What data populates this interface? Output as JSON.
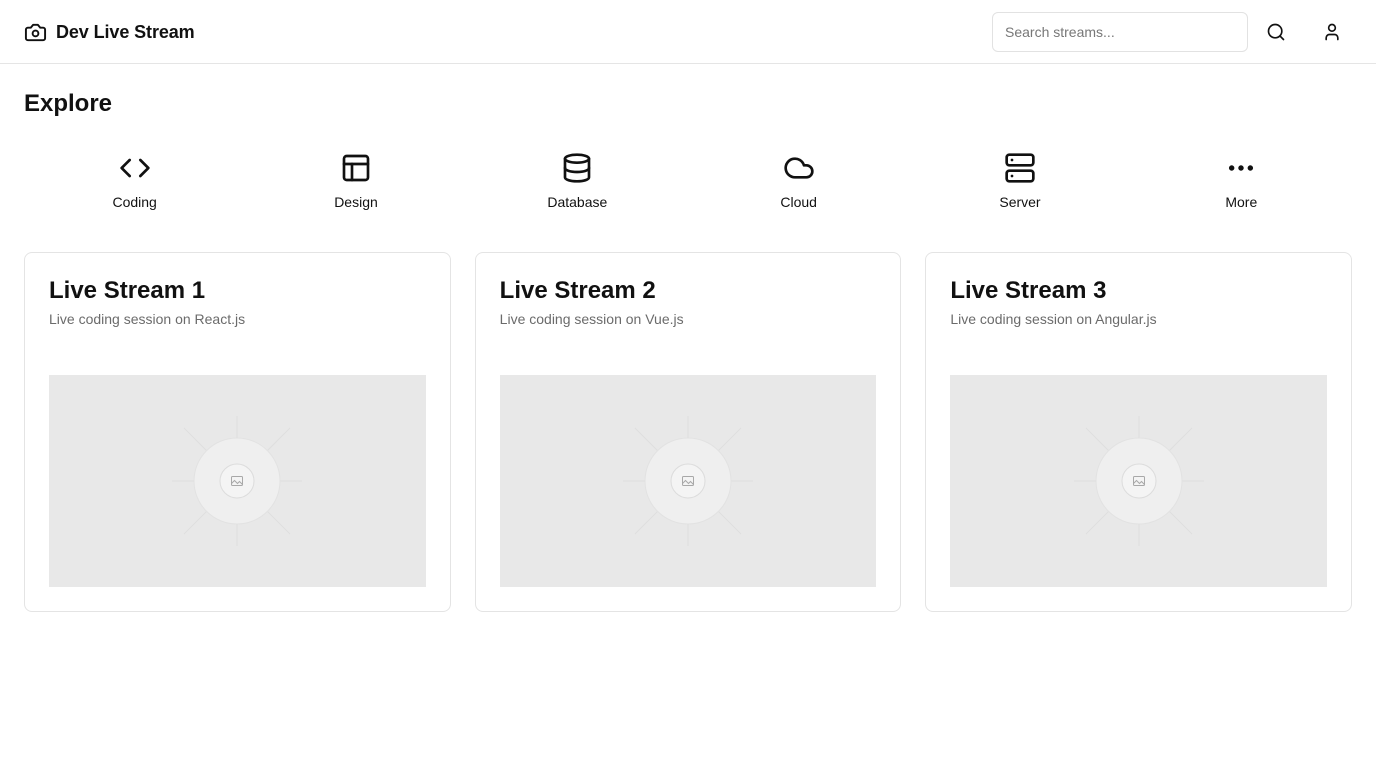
{
  "header": {
    "brand_icon": "camera-icon",
    "title": "Dev Live Stream",
    "search_placeholder": "Search streams...",
    "search_value": "",
    "search_icon": "search-icon",
    "profile_icon": "user-icon"
  },
  "main": {
    "title": "Explore",
    "categories": [
      {
        "label": "Coding",
        "icon": "code-icon"
      },
      {
        "label": "Design",
        "icon": "layout-icon"
      },
      {
        "label": "Database",
        "icon": "database-icon"
      },
      {
        "label": "Cloud",
        "icon": "cloud-icon"
      },
      {
        "label": "Server",
        "icon": "server-icon"
      },
      {
        "label": "More",
        "icon": "more-horizontal-icon"
      }
    ],
    "streams": [
      {
        "title": "Live Stream 1",
        "description": "Live coding session on React.js",
        "thumbnail": "image-placeholder-icon"
      },
      {
        "title": "Live Stream 2",
        "description": "Live coding session on Vue.js",
        "thumbnail": "image-placeholder-icon"
      },
      {
        "title": "Live Stream 3",
        "description": "Live coding session on Angular.js",
        "thumbnail": "image-placeholder-icon"
      }
    ]
  },
  "colors": {
    "text": "#111111",
    "muted_text": "#6b6b6b",
    "border": "#e4e4e4",
    "placeholder_bg": "#e8e8e8"
  }
}
